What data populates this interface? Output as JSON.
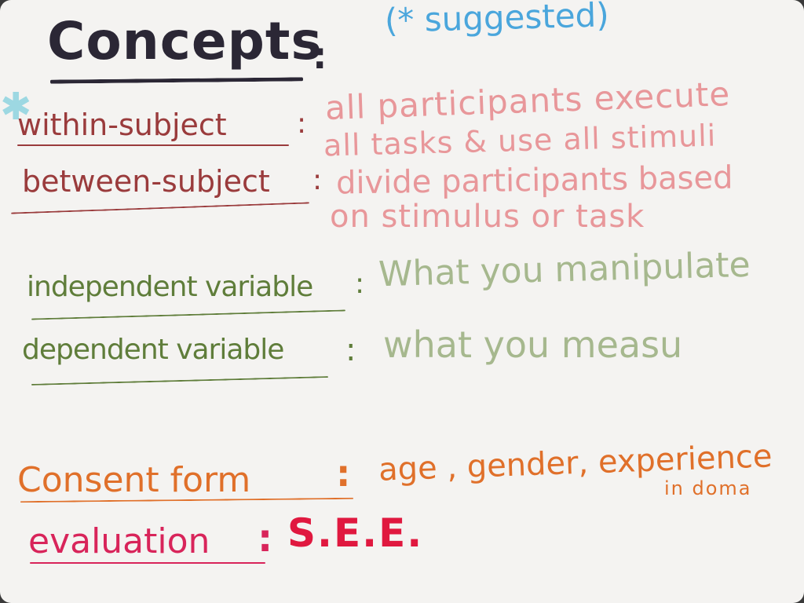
{
  "colors": {
    "heading": "#2b2735",
    "suggested": "#4aa6dc",
    "star_margin": "#9dd8e2",
    "subject_terms": "#9a3b3c",
    "subject_defs": "#e8979a",
    "variable_terms": "#5f7d3a",
    "variable_defs": "#a6b88e",
    "consent": "#e0702a",
    "evaluation_term": "#d8245a",
    "evaluation_value": "#e0183f"
  },
  "heading": {
    "title": "Concepts",
    "colon": ":",
    "suggested": "(* suggested)"
  },
  "margin_mark": {
    "icon": "asterisk-icon",
    "glyph": "✱"
  },
  "subjects": [
    {
      "term": "within-subject",
      "colon": ":",
      "definition_lines": [
        "all participants execute",
        "all tasks & use all stimuli"
      ]
    },
    {
      "term": "between-subject",
      "colon": ":",
      "definition_lines": [
        "divide participants based",
        "on stimulus or task"
      ]
    }
  ],
  "variables": [
    {
      "term": "independent variable",
      "colon": ":",
      "definition": "What you manipulate"
    },
    {
      "term": "dependent variable",
      "colon": ":",
      "definition": "what you measu"
    }
  ],
  "consent": {
    "term": "Consent form",
    "colon": ":",
    "value_main": "age , gender, experience",
    "value_sub": "in doma"
  },
  "evaluation": {
    "term": "evaluation",
    "colon": ":",
    "value": "S.E.E."
  }
}
